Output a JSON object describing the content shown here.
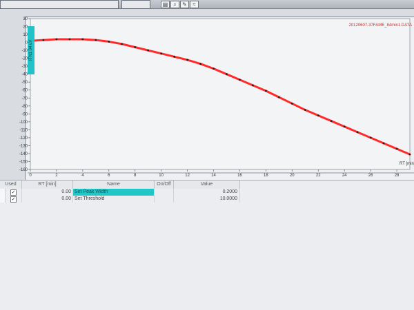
{
  "toolbar": {
    "icons": [
      "chart-icon",
      "zoom-icon",
      "pen-icon",
      "waves-icon"
    ]
  },
  "chart": {
    "file_label": "20120607-37FAME_84min1.DATA",
    "side_label": "ITN1 04 uV",
    "x_axis_label": "RT [min]"
  },
  "chart_data": {
    "type": "line",
    "xlabel": "RT [min]",
    "ylabel": "",
    "xlim": [
      0,
      29
    ],
    "ylim": [
      -160,
      30
    ],
    "x_ticks": [
      0,
      2,
      4,
      6,
      8,
      10,
      12,
      14,
      16,
      18,
      20,
      22,
      24,
      26,
      28
    ],
    "y_ticks": [
      30,
      20,
      10,
      0,
      -10,
      -20,
      -30,
      -40,
      -50,
      -60,
      -70,
      -80,
      -90,
      -100,
      -110,
      -120,
      -130,
      -140,
      -150,
      -160
    ],
    "series": [
      {
        "name": "",
        "color": "#ff2a2a",
        "x": [
          0,
          1,
          2,
          3,
          4,
          5,
          6,
          7,
          8,
          9,
          10,
          11,
          12,
          13,
          14,
          15,
          16,
          17,
          18,
          19,
          20,
          21,
          22,
          23,
          24,
          25,
          26,
          27,
          28,
          29
        ],
        "y": [
          2,
          3,
          4,
          4,
          4,
          3,
          1,
          -2,
          -6,
          -10,
          -14,
          -18,
          -22,
          -27,
          -33,
          -40,
          -47,
          -54,
          -61,
          -69,
          -77,
          -85,
          -92,
          -99,
          -106,
          -113,
          -120,
          -127,
          -134,
          -141
        ]
      }
    ]
  },
  "table": {
    "headers": [
      "Used",
      "RT [min]",
      "Name",
      "On/Off",
      "Value"
    ],
    "rows": [
      {
        "used": "✓",
        "rt": "0.00",
        "name": "Set Peak Width",
        "onoff": "",
        "value": "0.2000"
      },
      {
        "used": "✓",
        "rt": "0.00",
        "name": "Set Threshold",
        "onoff": "",
        "value": "10.0000"
      }
    ]
  }
}
